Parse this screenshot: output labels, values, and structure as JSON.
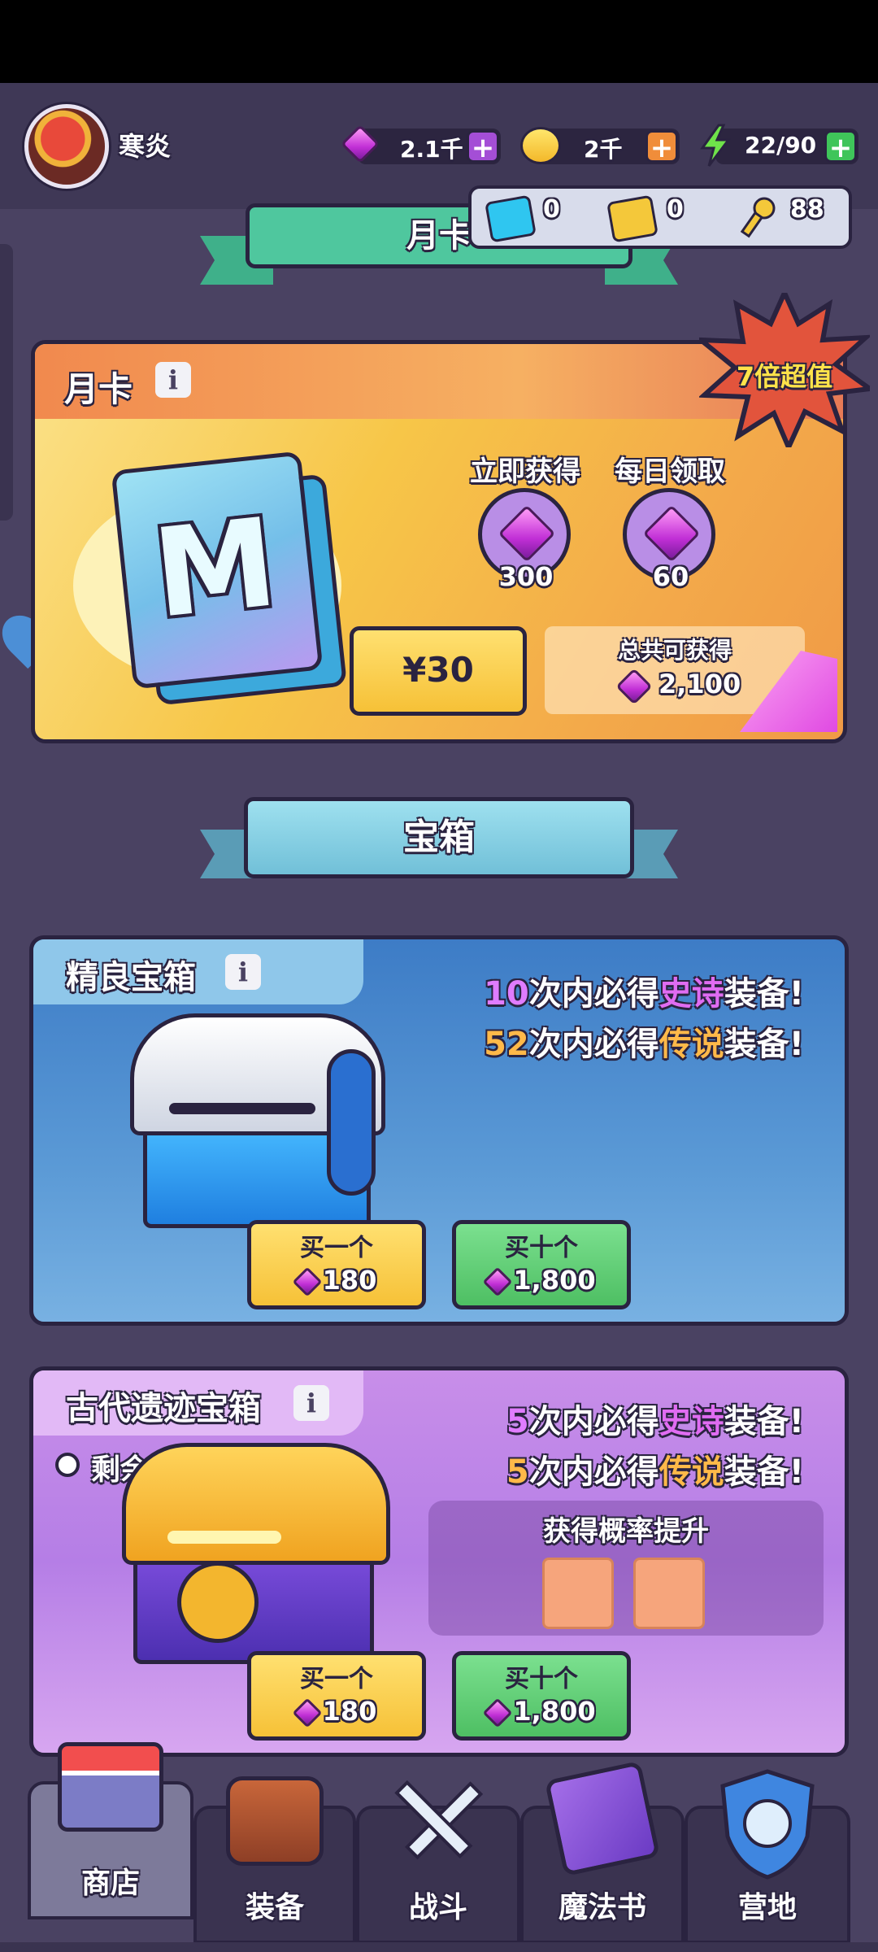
{
  "player": {
    "name": "寒炎"
  },
  "resources": {
    "gems": "2.1千",
    "coins": "2千",
    "energy": "22/90",
    "plus_symbol": "+"
  },
  "sub_resources": {
    "blue_ticket": "0",
    "gold_ticket": "0",
    "keys": "88"
  },
  "banner_top": {
    "label": "月卡"
  },
  "monthly_card": {
    "title": "月卡",
    "badge": "7倍超值",
    "book_letter": "M",
    "instant_label": "立即获得",
    "instant_amount": "300",
    "daily_label": "每日领取",
    "daily_amount": "60",
    "price": "¥30",
    "total_label": "总共可获得",
    "total_amount": "2,100"
  },
  "section_chests": {
    "label": "宝箱"
  },
  "chest_fine": {
    "title": "精良宝箱",
    "pity_epic_count": "10",
    "pity_epic_mid": "次内必得",
    "pity_epic_rarity": "史诗",
    "pity_epic_suffix": "装备!",
    "pity_legend_count": "52",
    "pity_legend_mid": "次内必得",
    "pity_legend_rarity": "传说",
    "pity_legend_suffix": "装备!",
    "buy_one_label": "买一个",
    "buy_one_price": "180",
    "buy_ten_label": "买十个",
    "buy_ten_price": "1,800"
  },
  "chest_ancient": {
    "title": "古代遗迹宝箱",
    "time_left": "剩余3天",
    "pity_epic_count": "5",
    "pity_epic_mid": "次内必得",
    "pity_epic_rarity": "史诗",
    "pity_epic_suffix": "装备!",
    "pity_legend_count": "5",
    "pity_legend_mid": "次内必得",
    "pity_legend_rarity": "传说",
    "pity_legend_suffix": "装备!",
    "boost_label": "获得概率提升",
    "buy_one_label": "买一个",
    "buy_one_price": "180",
    "buy_ten_label": "买十个",
    "buy_ten_price": "1,800"
  },
  "nav": {
    "shop": "商店",
    "equipment": "装备",
    "battle": "战斗",
    "spellbook": "魔法书",
    "camp": "营地"
  },
  "info_symbol": "i",
  "colors": {
    "background": "#4a4262",
    "topbar": "#3f3856",
    "outline": "#2a2340",
    "gem_purple": "#c12fd6",
    "button_yellow": "#f6c137",
    "button_green": "#4ebf63",
    "epic_text": "#e06cf2",
    "legend_text": "#ffb949"
  }
}
